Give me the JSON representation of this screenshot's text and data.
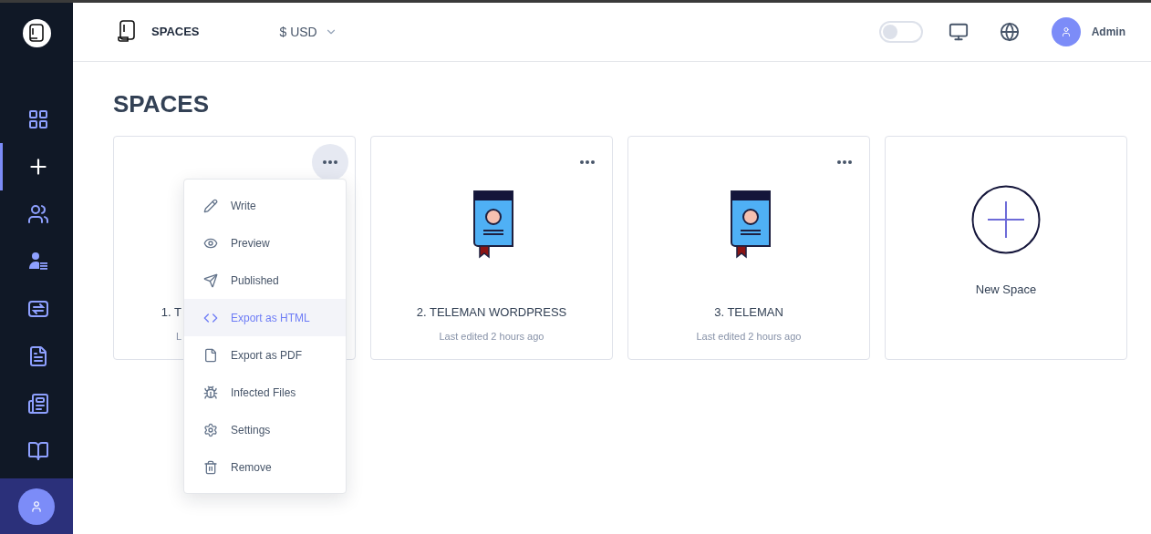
{
  "sidebar": {
    "items": [
      {
        "selected": false
      },
      {
        "selected": true
      },
      {
        "selected": false
      },
      {
        "selected": false
      },
      {
        "selected": false
      },
      {
        "selected": false
      },
      {
        "selected": false
      },
      {
        "selected": false
      }
    ]
  },
  "header": {
    "title": "SPACES",
    "currency": "$ USD",
    "theme_toggle": {
      "on": false
    },
    "user": "Admin"
  },
  "page_title": "SPACES",
  "cards": [
    {
      "kind": "space",
      "title": "1. T",
      "subtitle": "L",
      "menu_open": true
    },
    {
      "kind": "space",
      "title": "2. TELEMAN WORDPRESS",
      "subtitle": "Last edited 2 hours ago",
      "menu_open": false
    },
    {
      "kind": "space",
      "title": "3. TELEMAN",
      "subtitle": "Last edited 2 hours ago",
      "menu_open": false
    },
    {
      "kind": "new",
      "title": "New Space"
    }
  ],
  "menu": [
    {
      "label": "Write",
      "highlighted": false
    },
    {
      "label": "Preview",
      "highlighted": false
    },
    {
      "label": "Published",
      "highlighted": false
    },
    {
      "label": "Export as HTML",
      "highlighted": true
    },
    {
      "label": "Export as PDF",
      "highlighted": false
    },
    {
      "label": "Infected Files",
      "highlighted": false
    },
    {
      "label": "Settings",
      "highlighted": false
    },
    {
      "label": "Remove",
      "highlighted": false
    }
  ]
}
